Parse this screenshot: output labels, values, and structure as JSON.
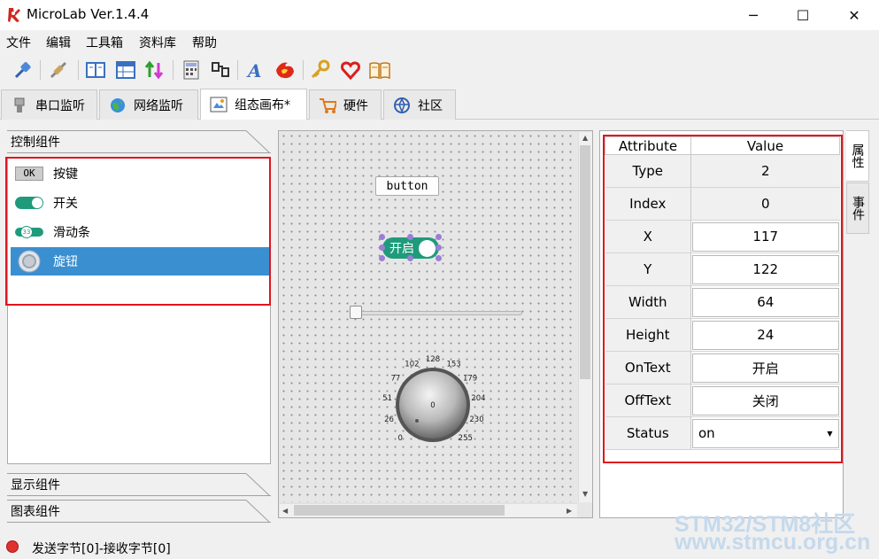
{
  "window": {
    "title": "MicroLab Ver.1.4.4",
    "minimize_glyph": "─",
    "maximize_glyph": "☐",
    "close_glyph": "✕"
  },
  "menu": [
    "文件",
    "编辑",
    "工具箱",
    "资料库",
    "帮助"
  ],
  "toolbar_icons": [
    "connect-icon",
    "disconnect-icon",
    "split-view-icon",
    "table-view-icon",
    "sort-icon",
    "calculator-icon",
    "plug-icon",
    "font-icon",
    "flame-icon",
    "key-icon",
    "heart-icon",
    "book-icon"
  ],
  "tabs": [
    {
      "label": "串口监听",
      "icon": "serial-icon"
    },
    {
      "label": "网络监听",
      "icon": "globe-icon"
    },
    {
      "label": "组态画布*",
      "icon": "canvas-icon"
    },
    {
      "label": "硬件",
      "icon": "cart-icon"
    },
    {
      "label": "社区",
      "icon": "community-icon"
    }
  ],
  "left_panel": {
    "section_control": "控制组件",
    "items": [
      {
        "label": "按键",
        "icon_text": "OK"
      },
      {
        "label": "开关"
      },
      {
        "label": "滑动条",
        "icon_text": "33"
      },
      {
        "label": "旋钮"
      }
    ],
    "section_display": "显示组件",
    "section_chart": "图表组件"
  },
  "canvas": {
    "button_text": "button",
    "switch_text": "开启",
    "knob_ticks": [
      "0",
      "26",
      "51",
      "77",
      "102",
      "128",
      "153",
      "179",
      "204",
      "230",
      "255"
    ],
    "knob_value_marker": "0"
  },
  "properties": {
    "header": {
      "attribute": "Attribute",
      "value": "Value"
    },
    "rows": [
      {
        "key": "Type",
        "value": "2"
      },
      {
        "key": "Index",
        "value": "0"
      },
      {
        "key": "X",
        "value": "117"
      },
      {
        "key": "Y",
        "value": "122"
      },
      {
        "key": "Width",
        "value": "64"
      },
      {
        "key": "Height",
        "value": "24"
      },
      {
        "key": "OnText",
        "value": "开启"
      },
      {
        "key": "OffText",
        "value": "关闭"
      },
      {
        "key": "Status",
        "value": "on"
      }
    ],
    "side_tabs": [
      "属性",
      "事件"
    ]
  },
  "status": {
    "text": "发送字节[0]-接收字节[0]",
    "led_color": "#e0322c"
  },
  "watermark": {
    "line1": "STM32/STM8社区",
    "line2": "www.stmcu.org.cn"
  }
}
